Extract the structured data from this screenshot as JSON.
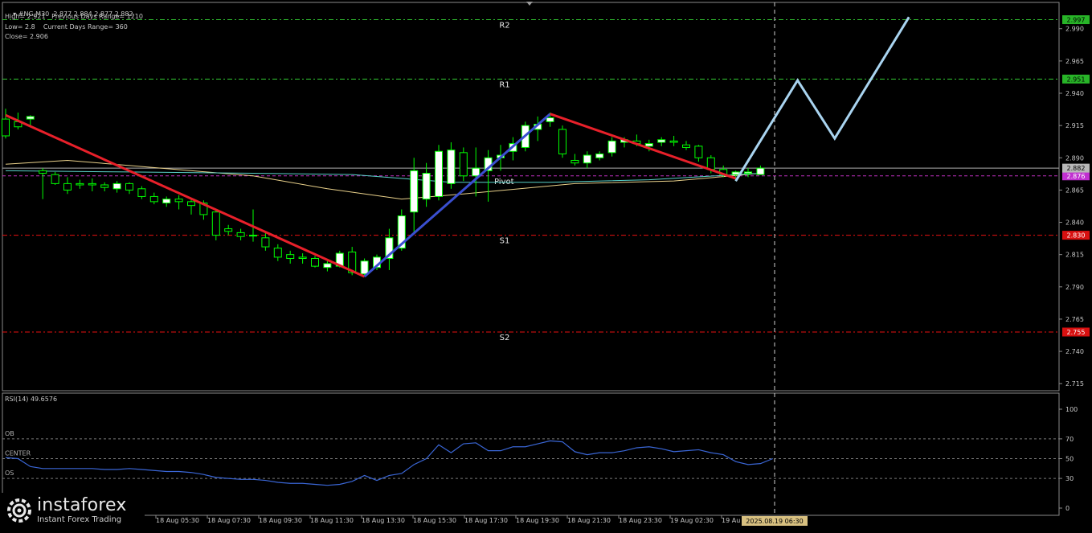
{
  "header": {
    "line1": "#NG,M30  2.877 2.884 2.877 2.882",
    "line2": "High= 2.921   Previous Days Range= 1210",
    "line3": "Low= 2.8    Current Days Range= 360",
    "line4": "Close= 2.906"
  },
  "rsi_header": "RSI(14) 49.6576",
  "logo": {
    "name": "instaforex",
    "tagline": "Instant Forex Trading"
  },
  "colors": {
    "background": "#000000",
    "bull_candle": "#ffffff",
    "bear_candle": "#000000",
    "candle_wick": "#00ff00",
    "down_trend": "#e8202a",
    "up_trend": "#3a4fd0",
    "forecast": "#a9d4f0",
    "resistance": "#32c832",
    "support": "#e81010",
    "current_price": "#b0b0b0",
    "pivot_line": "#c030c0",
    "rsi": "#3a66d6"
  },
  "chart_data": [
    {
      "type": "candlestick",
      "symbol": "#NG",
      "timeframe": "M30",
      "ylim": [
        2.705,
        3.005
      ],
      "yticks": [
        "2.990",
        "2.965",
        "2.940",
        "2.915",
        "2.890",
        "2.865",
        "2.840",
        "2.815",
        "2.790",
        "2.765",
        "2.740",
        "2.715"
      ],
      "xticks": [
        "18 Aug 05:30",
        "18 Aug 07:30",
        "18 Aug 09:30",
        "18 Aug 11:30",
        "18 Aug 13:30",
        "18 Aug 15:30",
        "18 Aug 17:30",
        "18 Aug 19:30",
        "18 Aug 21:30",
        "18 Aug 23:30",
        "19 Aug 02:30",
        "19 Au"
      ],
      "cursor_time": "2025.08.19 06:30",
      "levels": [
        {
          "name": "R2",
          "value": 2.997,
          "label": "2.997",
          "kind": "resistance"
        },
        {
          "name": "R1",
          "value": 2.951,
          "label": "2.951",
          "kind": "resistance"
        },
        {
          "name": "Pivot",
          "value": 2.876,
          "label": "2.876",
          "kind": "pivot"
        },
        {
          "name": "S1",
          "value": 2.83,
          "label": "2.830",
          "kind": "support"
        },
        {
          "name": "S2",
          "value": 2.755,
          "label": "2.755",
          "kind": "support"
        }
      ],
      "current_price": {
        "value": 2.882,
        "label": "2.882"
      },
      "candles": [
        [
          2.92,
          2.928,
          2.905,
          2.907
        ],
        [
          2.918,
          2.925,
          2.912,
          2.914
        ],
        [
          2.92,
          2.923,
          2.915,
          2.922
        ],
        [
          2.88,
          2.882,
          2.858,
          2.878
        ],
        [
          2.877,
          2.879,
          2.869,
          2.87
        ],
        [
          2.87,
          2.875,
          2.862,
          2.865
        ],
        [
          2.87,
          2.873,
          2.866,
          2.869
        ],
        [
          2.87,
          2.874,
          2.864,
          2.869
        ],
        [
          2.869,
          2.871,
          2.864,
          2.867
        ],
        [
          2.866,
          2.872,
          2.863,
          2.87
        ],
        [
          2.87,
          2.871,
          2.862,
          2.865
        ],
        [
          2.866,
          2.868,
          2.858,
          2.86
        ],
        [
          2.86,
          2.863,
          2.854,
          2.856
        ],
        [
          2.855,
          2.86,
          2.852,
          2.858
        ],
        [
          2.858,
          2.861,
          2.85,
          2.856
        ],
        [
          2.856,
          2.858,
          2.846,
          2.853
        ],
        [
          2.855,
          2.857,
          2.842,
          2.846
        ],
        [
          2.848,
          2.85,
          2.826,
          2.83
        ],
        [
          2.835,
          2.838,
          2.83,
          2.833
        ],
        [
          2.832,
          2.835,
          2.826,
          2.829
        ],
        [
          2.83,
          2.85,
          2.825,
          2.83
        ],
        [
          2.828,
          2.832,
          2.818,
          2.821
        ],
        [
          2.82,
          2.823,
          2.81,
          2.813
        ],
        [
          2.815,
          2.818,
          2.808,
          2.812
        ],
        [
          2.813,
          2.816,
          2.808,
          2.812
        ],
        [
          2.812,
          2.814,
          2.805,
          2.806
        ],
        [
          2.805,
          2.81,
          2.802,
          2.808
        ],
        [
          2.806,
          2.818,
          2.805,
          2.816
        ],
        [
          2.817,
          2.821,
          2.799,
          2.801
        ],
        [
          2.8,
          2.812,
          2.798,
          2.81
        ],
        [
          2.805,
          2.815,
          2.803,
          2.813
        ],
        [
          2.812,
          2.835,
          2.803,
          2.828
        ],
        [
          2.82,
          2.85,
          2.818,
          2.845
        ],
        [
          2.848,
          2.89,
          2.832,
          2.88
        ],
        [
          2.858,
          2.886,
          2.852,
          2.878
        ],
        [
          2.86,
          2.9,
          2.857,
          2.895
        ],
        [
          2.87,
          2.902,
          2.866,
          2.896
        ],
        [
          2.894,
          2.898,
          2.872,
          2.876
        ],
        [
          2.876,
          2.898,
          2.86,
          2.882
        ],
        [
          2.88,
          2.896,
          2.856,
          2.89
        ],
        [
          2.89,
          2.9,
          2.88,
          2.892
        ],
        [
          2.895,
          2.906,
          2.888,
          2.901
        ],
        [
          2.898,
          2.918,
          2.895,
          2.915
        ],
        [
          2.912,
          2.922,
          2.903,
          2.916
        ],
        [
          2.918,
          2.925,
          2.914,
          2.921
        ],
        [
          2.912,
          2.915,
          2.89,
          2.893
        ],
        [
          2.888,
          2.893,
          2.884,
          2.886
        ],
        [
          2.886,
          2.895,
          2.882,
          2.892
        ],
        [
          2.89,
          2.895,
          2.888,
          2.893
        ],
        [
          2.894,
          2.906,
          2.891,
          2.903
        ],
        [
          2.902,
          2.906,
          2.898,
          2.904
        ],
        [
          2.903,
          2.908,
          2.899,
          2.901
        ],
        [
          2.899,
          2.904,
          2.895,
          2.901
        ],
        [
          2.902,
          2.906,
          2.899,
          2.904
        ],
        [
          2.903,
          2.907,
          2.899,
          2.902
        ],
        [
          2.9,
          2.903,
          2.896,
          2.898
        ],
        [
          2.899,
          2.9,
          2.887,
          2.89
        ],
        [
          2.89,
          2.892,
          2.878,
          2.881
        ],
        [
          2.881,
          2.884,
          2.875,
          2.877
        ],
        [
          2.877,
          2.88,
          2.872,
          2.879
        ],
        [
          2.878,
          2.882,
          2.875,
          2.879
        ],
        [
          2.877,
          2.884,
          2.877,
          2.882
        ]
      ],
      "moving_averages": [
        {
          "color": "#e8d08a",
          "points": [
            [
              0,
              2.885
            ],
            [
              5,
              2.888
            ],
            [
              10,
              2.884
            ],
            [
              20,
              2.876
            ],
            [
              26,
              2.866
            ],
            [
              32,
              2.858
            ],
            [
              37,
              2.862
            ],
            [
              46,
              2.87
            ],
            [
              54,
              2.872
            ],
            [
              61,
              2.878
            ]
          ]
        },
        {
          "color": "#58d0c8",
          "points": [
            [
              0,
              2.88
            ],
            [
              10,
              2.879
            ],
            [
              20,
              2.878
            ],
            [
              28,
              2.877
            ],
            [
              36,
              2.871
            ],
            [
              44,
              2.871
            ],
            [
              52,
              2.873
            ],
            [
              61,
              2.878
            ]
          ]
        }
      ],
      "trend_lines": [
        {
          "kind": "down_trend",
          "points": [
            [
              0,
              2.923
            ],
            [
              29,
              2.798
            ]
          ]
        },
        {
          "kind": "up_trend",
          "points": [
            [
              29,
              2.798
            ],
            [
              44,
              2.924
            ]
          ]
        },
        {
          "kind": "down_trend",
          "points": [
            [
              44,
              2.924
            ],
            [
              59,
              2.874
            ]
          ]
        }
      ],
      "forecast_path": [
        [
          59,
          2.872
        ],
        [
          64,
          2.95
        ],
        [
          67,
          2.905
        ],
        [
          73,
          2.999
        ]
      ]
    },
    {
      "type": "line",
      "indicator": "RSI(14)",
      "value": 49.6576,
      "ylim": [
        0,
        100
      ],
      "yticks": [
        "100",
        "70",
        "50",
        "30",
        "0"
      ],
      "levels": [
        {
          "name": "OB",
          "value": 70
        },
        {
          "name": "CENTER",
          "value": 50
        },
        {
          "name": "OS",
          "value": 30
        }
      ],
      "values": [
        51,
        50,
        42,
        40,
        40,
        40,
        40,
        40,
        39,
        39,
        40,
        39,
        38,
        37,
        37,
        36,
        34,
        31,
        30,
        29,
        29,
        28,
        26,
        25,
        25,
        24,
        23,
        24,
        27,
        33,
        28,
        33,
        35,
        44,
        50,
        64,
        56,
        65,
        66,
        58,
        58,
        62,
        62,
        65,
        68,
        67,
        57,
        54,
        56,
        56,
        58,
        61,
        62,
        60,
        57,
        58,
        59,
        56,
        54,
        47,
        44,
        45,
        50
      ]
    }
  ]
}
